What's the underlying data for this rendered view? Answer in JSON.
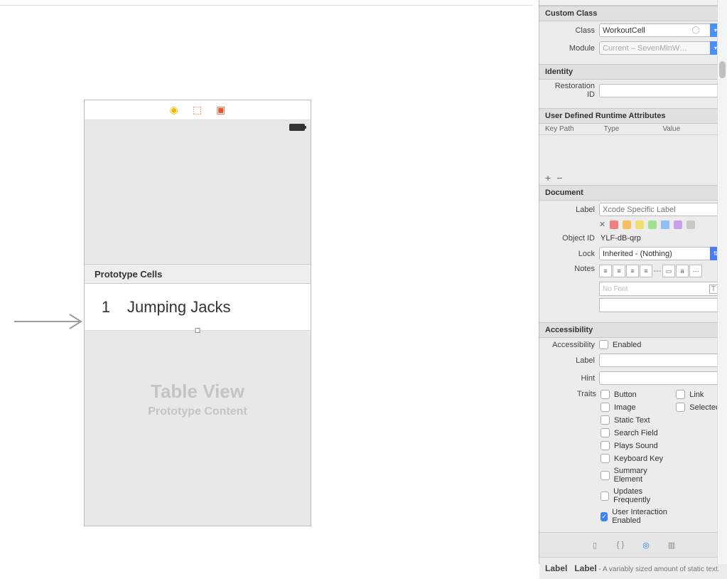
{
  "canvas": {
    "prototype_header": "Prototype Cells",
    "cell_number": "1",
    "cell_title": "Jumping Jacks",
    "tableview_title": "Table View",
    "tableview_subtitle": "Prototype Content"
  },
  "inspector": {
    "custom_class": {
      "section": "Custom Class",
      "class_label": "Class",
      "class_value": "WorkoutCell",
      "module_label": "Module",
      "module_value": "Current – SevenMinW…"
    },
    "identity": {
      "section": "Identity",
      "restoration_label": "Restoration ID",
      "restoration_value": ""
    },
    "udra": {
      "section": "User Defined Runtime Attributes",
      "col_keypath": "Key Path",
      "col_type": "Type",
      "col_value": "Value"
    },
    "document": {
      "section": "Document",
      "label_label": "Label",
      "label_placeholder": "Xcode Specific Label",
      "object_id_label": "Object ID",
      "object_id_value": "YLF-dB-qrp",
      "lock_label": "Lock",
      "lock_value": "Inherited - (Nothing)",
      "notes_label": "Notes",
      "nofont": "No Font"
    },
    "accessibility": {
      "section": "Accessibility",
      "accessibility_label": "Accessibility",
      "enabled_label": "Enabled",
      "label_label": "Label",
      "hint_label": "Hint",
      "traits_label": "Traits",
      "traits": {
        "button": "Button",
        "image": "Image",
        "static_text": "Static Text",
        "search_field": "Search Field",
        "plays_sound": "Plays Sound",
        "keyboard_key": "Keyboard Key",
        "summary_element": "Summary Element",
        "updates_frequently": "Updates Frequently",
        "user_interaction": "User Interaction Enabled",
        "link": "Link",
        "selected": "Selected"
      }
    },
    "library": {
      "item_title_bold": "Label",
      "item_title_rest": "Label",
      "item_desc": " - A variably sized amount of static text."
    }
  }
}
